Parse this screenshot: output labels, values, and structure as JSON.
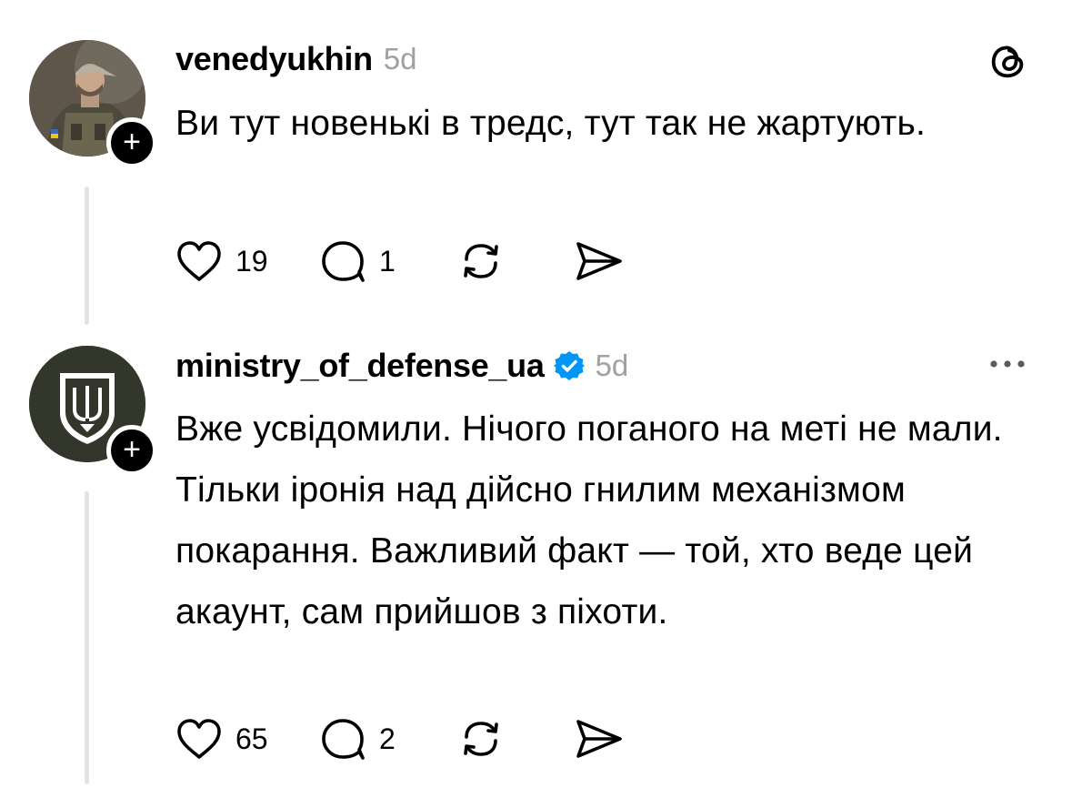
{
  "posts": [
    {
      "username": "venedyukhin",
      "time": "5d",
      "verified": false,
      "text": "Ви тут новенькі в тредс, тут так не жартують.",
      "likes": "19",
      "replies": "1",
      "avatar_icon": "soldier-photo",
      "corner_icon": "threads-logo-icon"
    },
    {
      "username": "ministry_of_defense_ua",
      "time": "5d",
      "verified": true,
      "text": "Вже усвідомили. Нічого поганого на меті не мали. Тільки іронія над дійсно гнилим механізмом покарання. Важливий факт — той, хто веде цей акаунт, сам прийшов з піхоти.",
      "likes": "65",
      "replies": "2",
      "avatar_icon": "trident-shield-logo",
      "corner_icon": "more-icon"
    }
  ],
  "colors": {
    "verified_blue": "#0095f6",
    "muted_text": "#a0a0a0",
    "thread_line": "#e3e3e3",
    "mod_avatar_bg": "#33372b"
  },
  "follow_badge_symbol": "+"
}
